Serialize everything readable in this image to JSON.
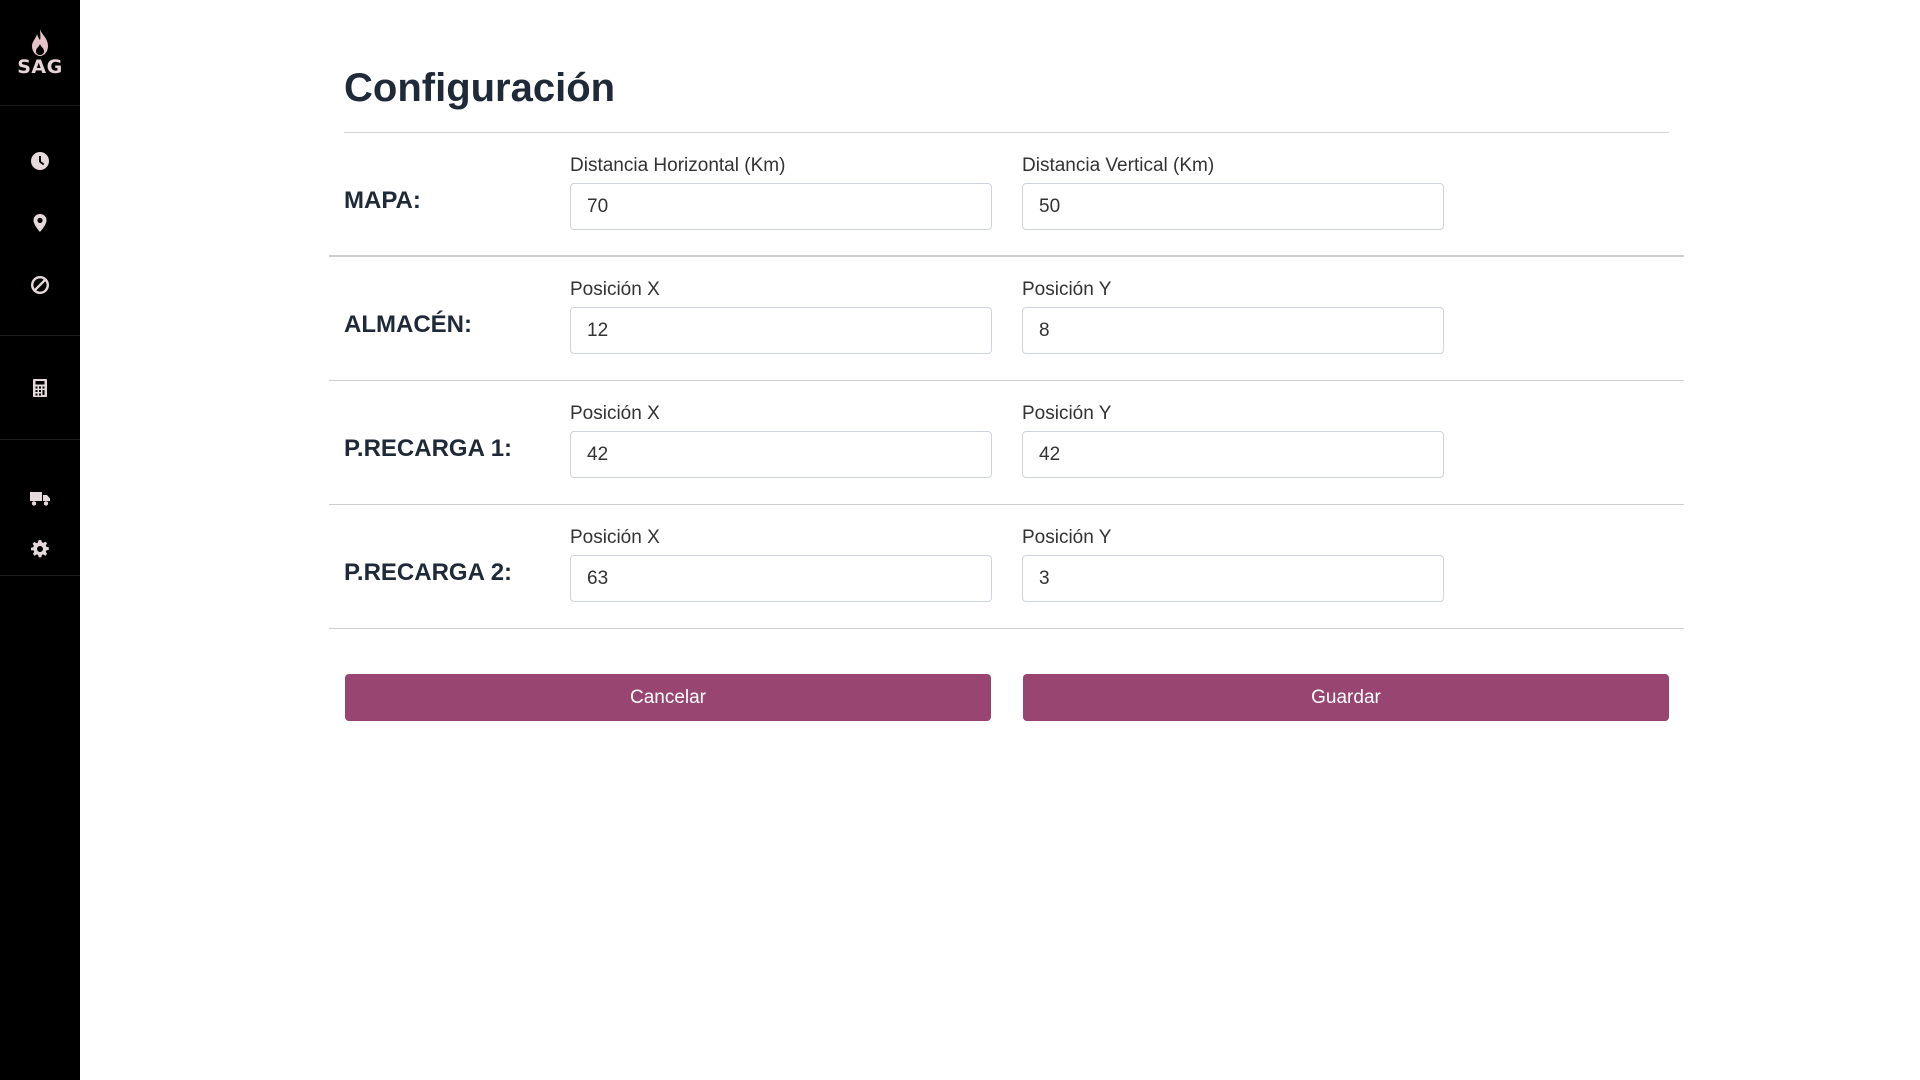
{
  "sidebar": {
    "logo_text": "SAG",
    "items": [
      {
        "icon": "clock-icon",
        "name": "sidebar-item-clock"
      },
      {
        "icon": "map-marker-icon",
        "name": "sidebar-item-location"
      },
      {
        "icon": "ban-icon",
        "name": "sidebar-item-blocked"
      },
      {
        "icon": "calculator-icon",
        "name": "sidebar-item-calculator"
      },
      {
        "icon": "truck-icon",
        "name": "sidebar-item-trucks"
      },
      {
        "icon": "gear-icon",
        "name": "sidebar-item-settings"
      }
    ],
    "icon_color": "#e6d9db",
    "background": "#000000"
  },
  "main": {
    "title": "Configuración",
    "sections": [
      {
        "label": "MAPA:",
        "fields": [
          {
            "label": "Distancia Horizontal (Km)",
            "value": "70"
          },
          {
            "label": "Distancia Vertical (Km)",
            "value": "50"
          }
        ]
      },
      {
        "label": "ALMACÉN:",
        "fields": [
          {
            "label": "Posición X",
            "value": "12"
          },
          {
            "label": "Posición Y",
            "value": "8"
          }
        ]
      },
      {
        "label": "P.RECARGA 1:",
        "fields": [
          {
            "label": "Posición X",
            "value": "42"
          },
          {
            "label": "Posición Y",
            "value": "42"
          }
        ]
      },
      {
        "label": "P.RECARGA 2:",
        "fields": [
          {
            "label": "Posición X",
            "value": "63"
          },
          {
            "label": "Posición Y",
            "value": "3"
          }
        ]
      }
    ],
    "buttons": {
      "cancel_label": "Cancelar",
      "save_label": "Guardar"
    },
    "accent_color": "#984671"
  }
}
